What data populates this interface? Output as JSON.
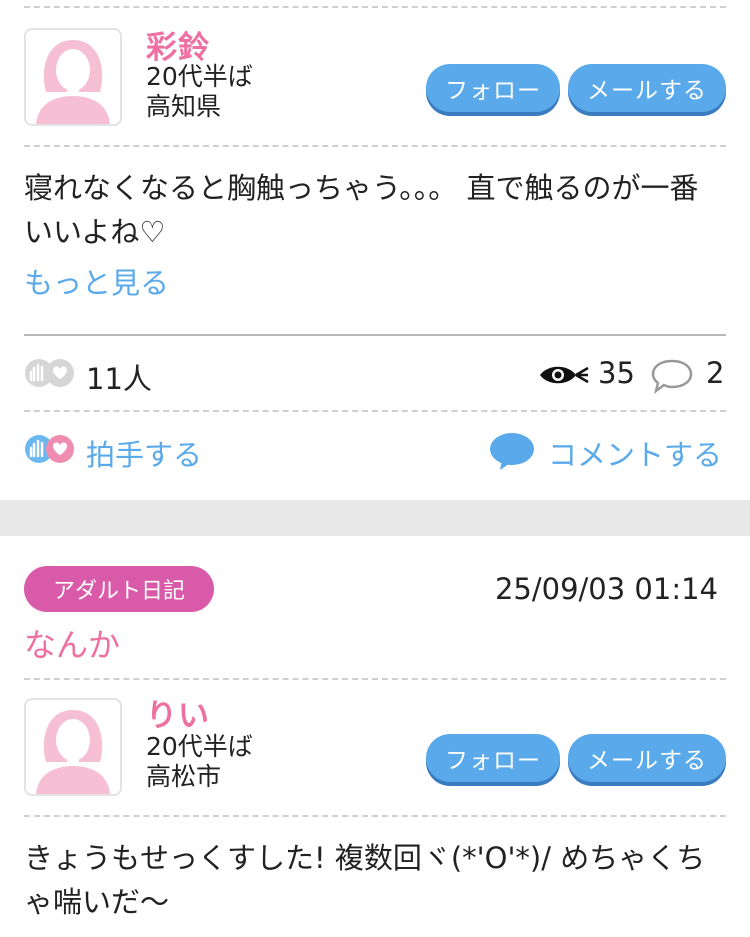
{
  "post1": {
    "user_name": "彩鈴",
    "age": "20代半ば",
    "location": "高知県",
    "follow_label": "フォロー",
    "mail_label": "メールする",
    "body": "寝れなくなると胸触っちゃう。。。 直で触るのが一番いいよね♡",
    "more_label": "もっと見る",
    "clap_count": "11人",
    "views": "35",
    "comments": "2",
    "clap_action": "拍手する",
    "comment_action": "コメントする"
  },
  "post2": {
    "badge": "アダルト日記",
    "date": "25/09/03 01:14",
    "title": "なんか",
    "user_name": "りい",
    "age": "20代半ば",
    "location": "高松市",
    "follow_label": "フォロー",
    "mail_label": "メールする",
    "body": "きょうもせっくすした! 複数回ヾ(*'O'*)/ めちゃくちゃ喘いだ〜"
  },
  "colors": {
    "accent_blue": "#5aa9ea",
    "name_pink": "#ee6fa0",
    "badge_magenta": "#d95aa8"
  },
  "icons": [
    "avatar-silhouette-icon",
    "clap-hands-icon",
    "eye-icon",
    "speech-bubble-icon"
  ]
}
